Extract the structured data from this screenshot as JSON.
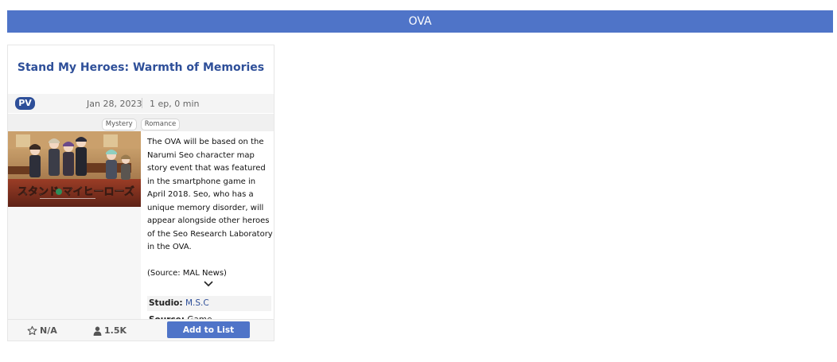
{
  "section": {
    "title": "OVA"
  },
  "card": {
    "title": "Stand My Heroes: Warmth of Memories",
    "badge": "PV",
    "date": "Jan 28, 2023",
    "episodes": "1 ep, 0 min",
    "genres": [
      "Mystery",
      "Romance"
    ],
    "cover_text": "スタンド マイヒーローズ",
    "synopsis": "The OVA will be based on the Narumi Seo character map story event that was featured in the smartphone game in April 2018. Seo, who has a unique memory disorder, will appear alongside other heroes of the Seo Research Laboratory in the OVA.",
    "synopsis_source": "(Source: MAL News)",
    "studio_label": "Studio:",
    "studio_value": "M.S.C",
    "source_label": "Source:",
    "source_value": "Game",
    "score": "N/A",
    "members": "1.5K",
    "add_button": "Add to List"
  },
  "icons": {
    "expand": "chevron-down-icon",
    "score": "star-icon",
    "members": "user-icon"
  },
  "colors": {
    "accent": "#4f74c8",
    "title": "#2e4f99",
    "badge": "#2e4f99"
  }
}
